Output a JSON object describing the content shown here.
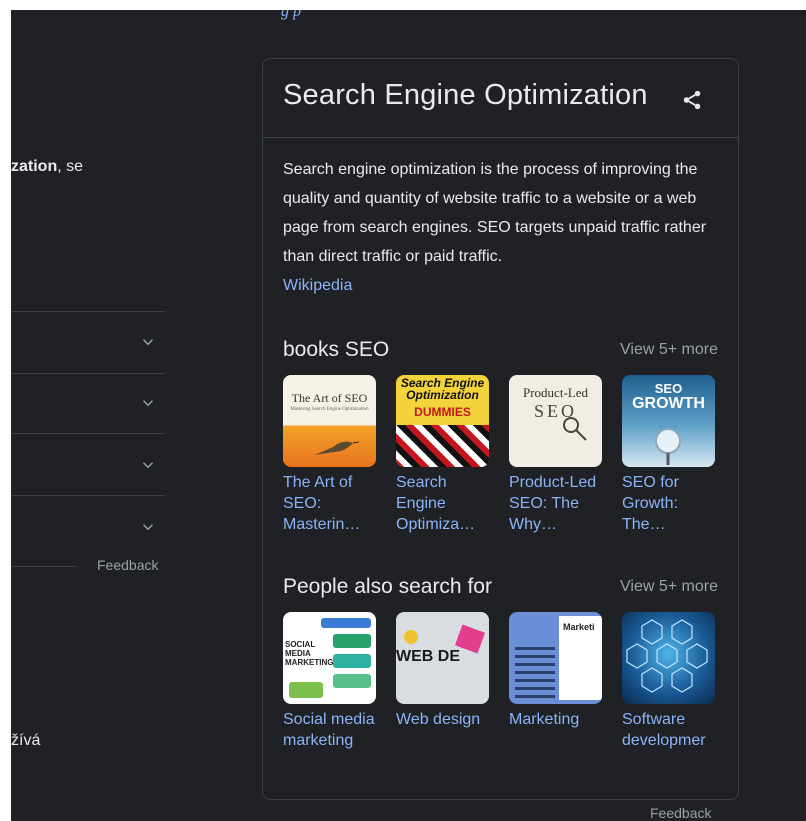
{
  "top_fragment": "g p",
  "left": {
    "snippet_bold": "zation",
    "snippet_rest": ", se",
    "feedback": "Feedback",
    "bottom_text": "žívá"
  },
  "panel": {
    "title": "Search Engine Optimization",
    "description": "Search engine optimization is the process of improving the quality and quantity of website traffic to a website or a web page from search engines. SEO targets unpaid traffic rather than direct traffic or paid traffic.",
    "source_link": "Wikipedia",
    "books": {
      "heading": "books SEO",
      "view_more": "View 5+ more",
      "items": [
        {
          "label": "The Art of SEO: Masterin…"
        },
        {
          "label": "Search Engine Optimiza…"
        },
        {
          "label": "Product-Led SEO: The Why…"
        },
        {
          "label": "SEO for Growth: The…"
        }
      ],
      "covers": [
        {
          "line1": "The Art of SEO",
          "line2": "Mastering Search Engine Optimization"
        },
        {
          "line1": "Search Engine Optimization",
          "line2": "DUMMIES"
        },
        {
          "line1": "Product-Led",
          "line2": "SEO"
        },
        {
          "line1": "SEO",
          "line2": "GROWTH"
        }
      ]
    },
    "people": {
      "heading": "People also search for",
      "view_more": "View 5+ more",
      "items": [
        {
          "label": "Social media marketing",
          "thumb_text": "SOCIAL MEDIA MARKETING"
        },
        {
          "label": "Web design",
          "thumb_text": "WEB DE"
        },
        {
          "label": "Marketing",
          "thumb_text": "Marketi"
        },
        {
          "label": "Software developmer"
        }
      ]
    },
    "feedback": "Feedback"
  },
  "colors": {
    "background": "#202124",
    "text": "#e8eaed",
    "link": "#8ab4f8",
    "muted": "#9aa0a6",
    "border": "#3c4043"
  },
  "icons": [
    "chevron-down-icon",
    "share-icon"
  ]
}
